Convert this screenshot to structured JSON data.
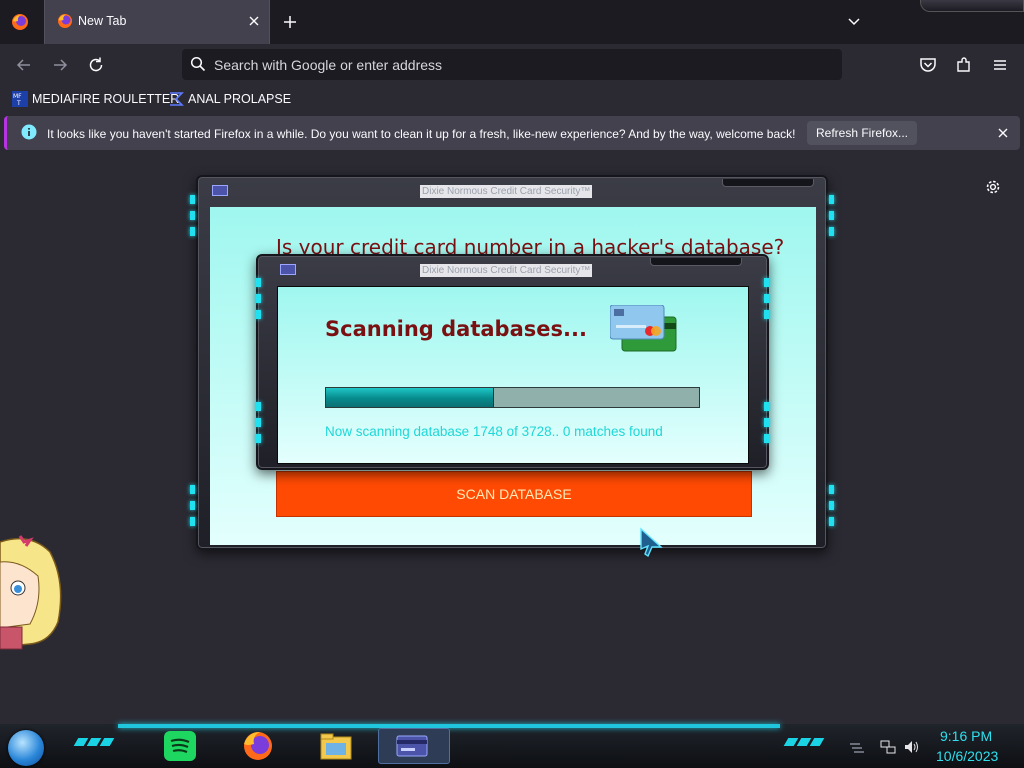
{
  "browser": {
    "tab": {
      "title": "New Tab"
    },
    "urlbar": {
      "placeholder": "Search with Google or enter address"
    },
    "bookmarks": [
      {
        "label": "MEDIAFIRE ROULETTER",
        "icon": "mediafire-favicon",
        "favicon_text": "MF T"
      },
      {
        "label": "ANAL PROLAPSE",
        "icon": "sigma-favicon"
      }
    ],
    "infobar": {
      "message": "It looks like you haven't started Firefox in a while. Do you want to clean it up for a fresh, like-new experience? And by the way, welcome back!",
      "button_label": "Refresh Firefox..."
    }
  },
  "app": {
    "window_title": "Dixie Normous Credit Card Security™",
    "heading": "Is your credit card number in a hacker's database?",
    "scan_button_label": "SCAN DATABASE",
    "dialog": {
      "title": "Dixie Normous Credit Card Security™",
      "scanning_title": "Scanning databases...",
      "status": "Now scanning database 1748 of 3728.. 0 matches found",
      "progress": 0.45
    }
  },
  "taskbar": {
    "apps": [
      "spotify-icon",
      "firefox-icon",
      "file-explorer-icon",
      "credit-card-app-icon"
    ],
    "clock": {
      "time": "9:16 PM",
      "date": "10/6/2023"
    }
  },
  "colors": {
    "accent_cyan": "#21e0f0",
    "heading_red": "#7a1012",
    "scan_button": "#ff4a04",
    "infobar_accent": "#b833e1"
  }
}
